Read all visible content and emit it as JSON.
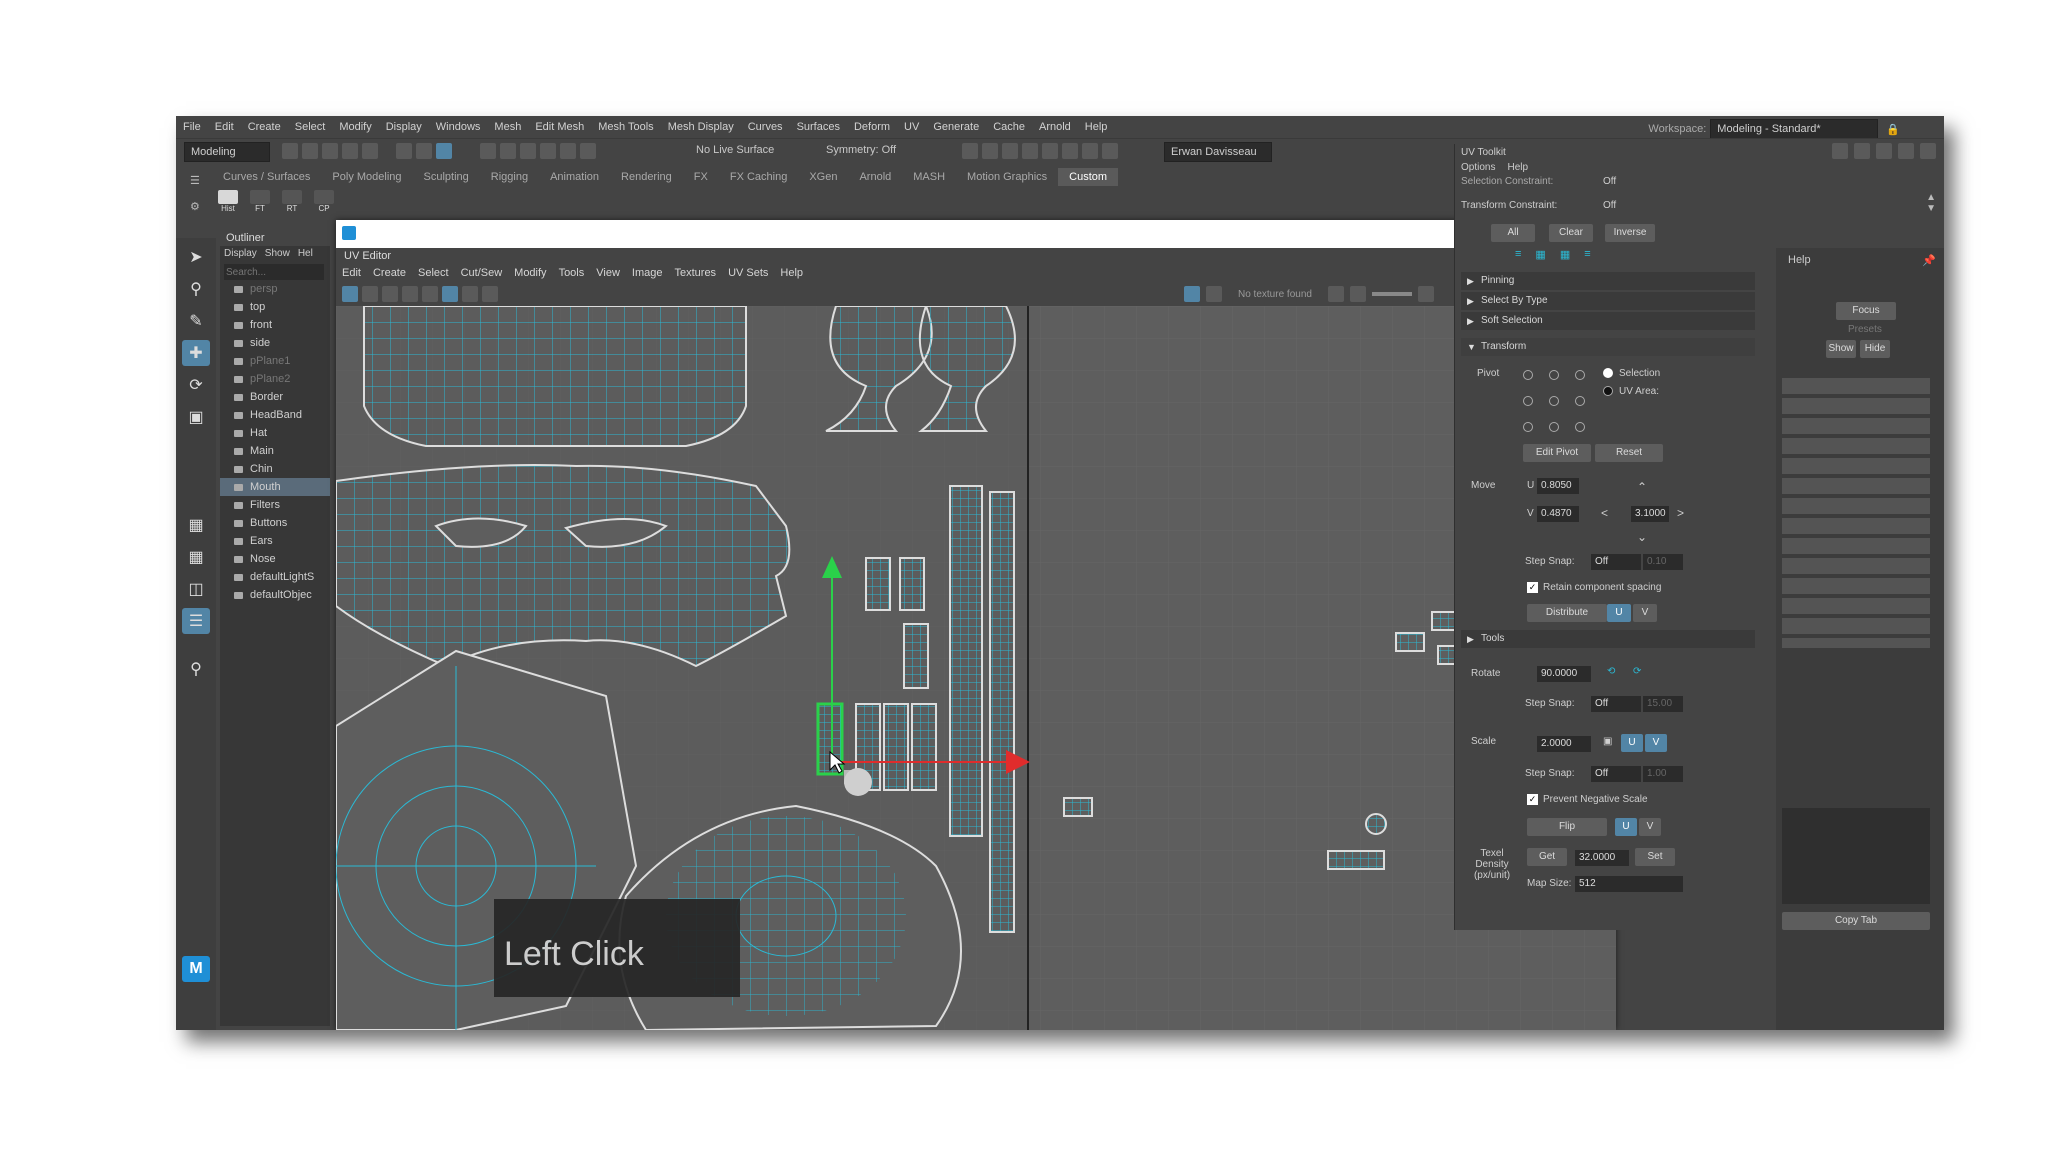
{
  "menubar": [
    "File",
    "Edit",
    "Create",
    "Select",
    "Modify",
    "Display",
    "Windows",
    "Mesh",
    "Edit Mesh",
    "Mesh Tools",
    "Mesh Display",
    "Curves",
    "Surfaces",
    "Deform",
    "UV",
    "Generate",
    "Cache",
    "Arnold",
    "Help"
  ],
  "workspace": {
    "label": "Workspace:",
    "value": "Modeling - Standard*"
  },
  "toolbar": {
    "mode": "Modeling",
    "live_surface": "No Live Surface",
    "symmetry": "Symmetry: Off",
    "user": "Erwan Davisseau"
  },
  "shelf_tabs": [
    "Curves / Surfaces",
    "Poly Modeling",
    "Sculpting",
    "Rigging",
    "Animation",
    "Rendering",
    "FX",
    "FX Caching",
    "XGen",
    "Arnold",
    "MASH",
    "Motion Graphics",
    "Custom"
  ],
  "shelf_icons": [
    "Hist",
    "FT",
    "RT",
    "CP"
  ],
  "outliner": {
    "title": "Outliner",
    "menu": [
      "Display",
      "Show",
      "Hel"
    ],
    "search": "Search...",
    "items": [
      "persp",
      "top",
      "front",
      "side",
      "pPlane1",
      "pPlane2",
      "Border",
      "HeadBand",
      "Hat",
      "Main",
      "Chin",
      "Mouth",
      "Filters",
      "Buttons",
      "Ears",
      "Nose",
      "defaultLightS",
      "defaultObjec"
    ]
  },
  "uv_editor": {
    "title": "UV Editor",
    "menu": [
      "Edit",
      "Create",
      "Select",
      "Cut/Sew",
      "Modify",
      "Tools",
      "View",
      "Image",
      "Textures",
      "UV Sets",
      "Help"
    ],
    "texture_status": "No texture found"
  },
  "overlay": "Left Click",
  "uv_toolkit": {
    "title": "UV Toolkit",
    "menu": [
      "Options",
      "Help"
    ],
    "selection_constraint": "Selection Constraint:",
    "selection_constraint_val": "Off",
    "transform_constraint": "Transform Constraint:",
    "transform_constraint_val": "Off",
    "sel_buttons": [
      "All",
      "Clear",
      "Inverse"
    ],
    "sections": [
      "Pinning",
      "Select By Type",
      "Soft Selection",
      "Transform",
      "Tools"
    ],
    "pivot": "Pivot",
    "pivot_selection": "Selection",
    "pivot_uv_area": "UV Area:",
    "edit_pivot": "Edit Pivot",
    "reset": "Reset",
    "move": "Move",
    "u_label": "U",
    "v_label": "V",
    "move_u": "0.8050",
    "move_v": "0.4870",
    "move_step": "3.1000",
    "step_snap": "Step Snap:",
    "step_snap_val": "Off",
    "step_snap_num1": "0.10",
    "retain_spacing": "Retain component spacing",
    "distribute": "Distribute",
    "rotate": "Rotate",
    "rotate_val": "90.0000",
    "step_snap_num2": "15.00",
    "scale": "Scale",
    "scale_val": "2.0000",
    "step_snap_num3": "1.00",
    "prevent_negative": "Prevent Negative Scale",
    "flip": "Flip",
    "texel_density": "Texel Density (px/unit)",
    "get": "Get",
    "texel_val": "32.0000",
    "set": "Set",
    "map_size_label": "Map Size:",
    "map_size": "512"
  },
  "right_panel": {
    "help": "Help",
    "focus": "Focus",
    "presets": "Presets",
    "show": "Show",
    "hide": "Hide",
    "copy_tab": "Copy Tab"
  }
}
